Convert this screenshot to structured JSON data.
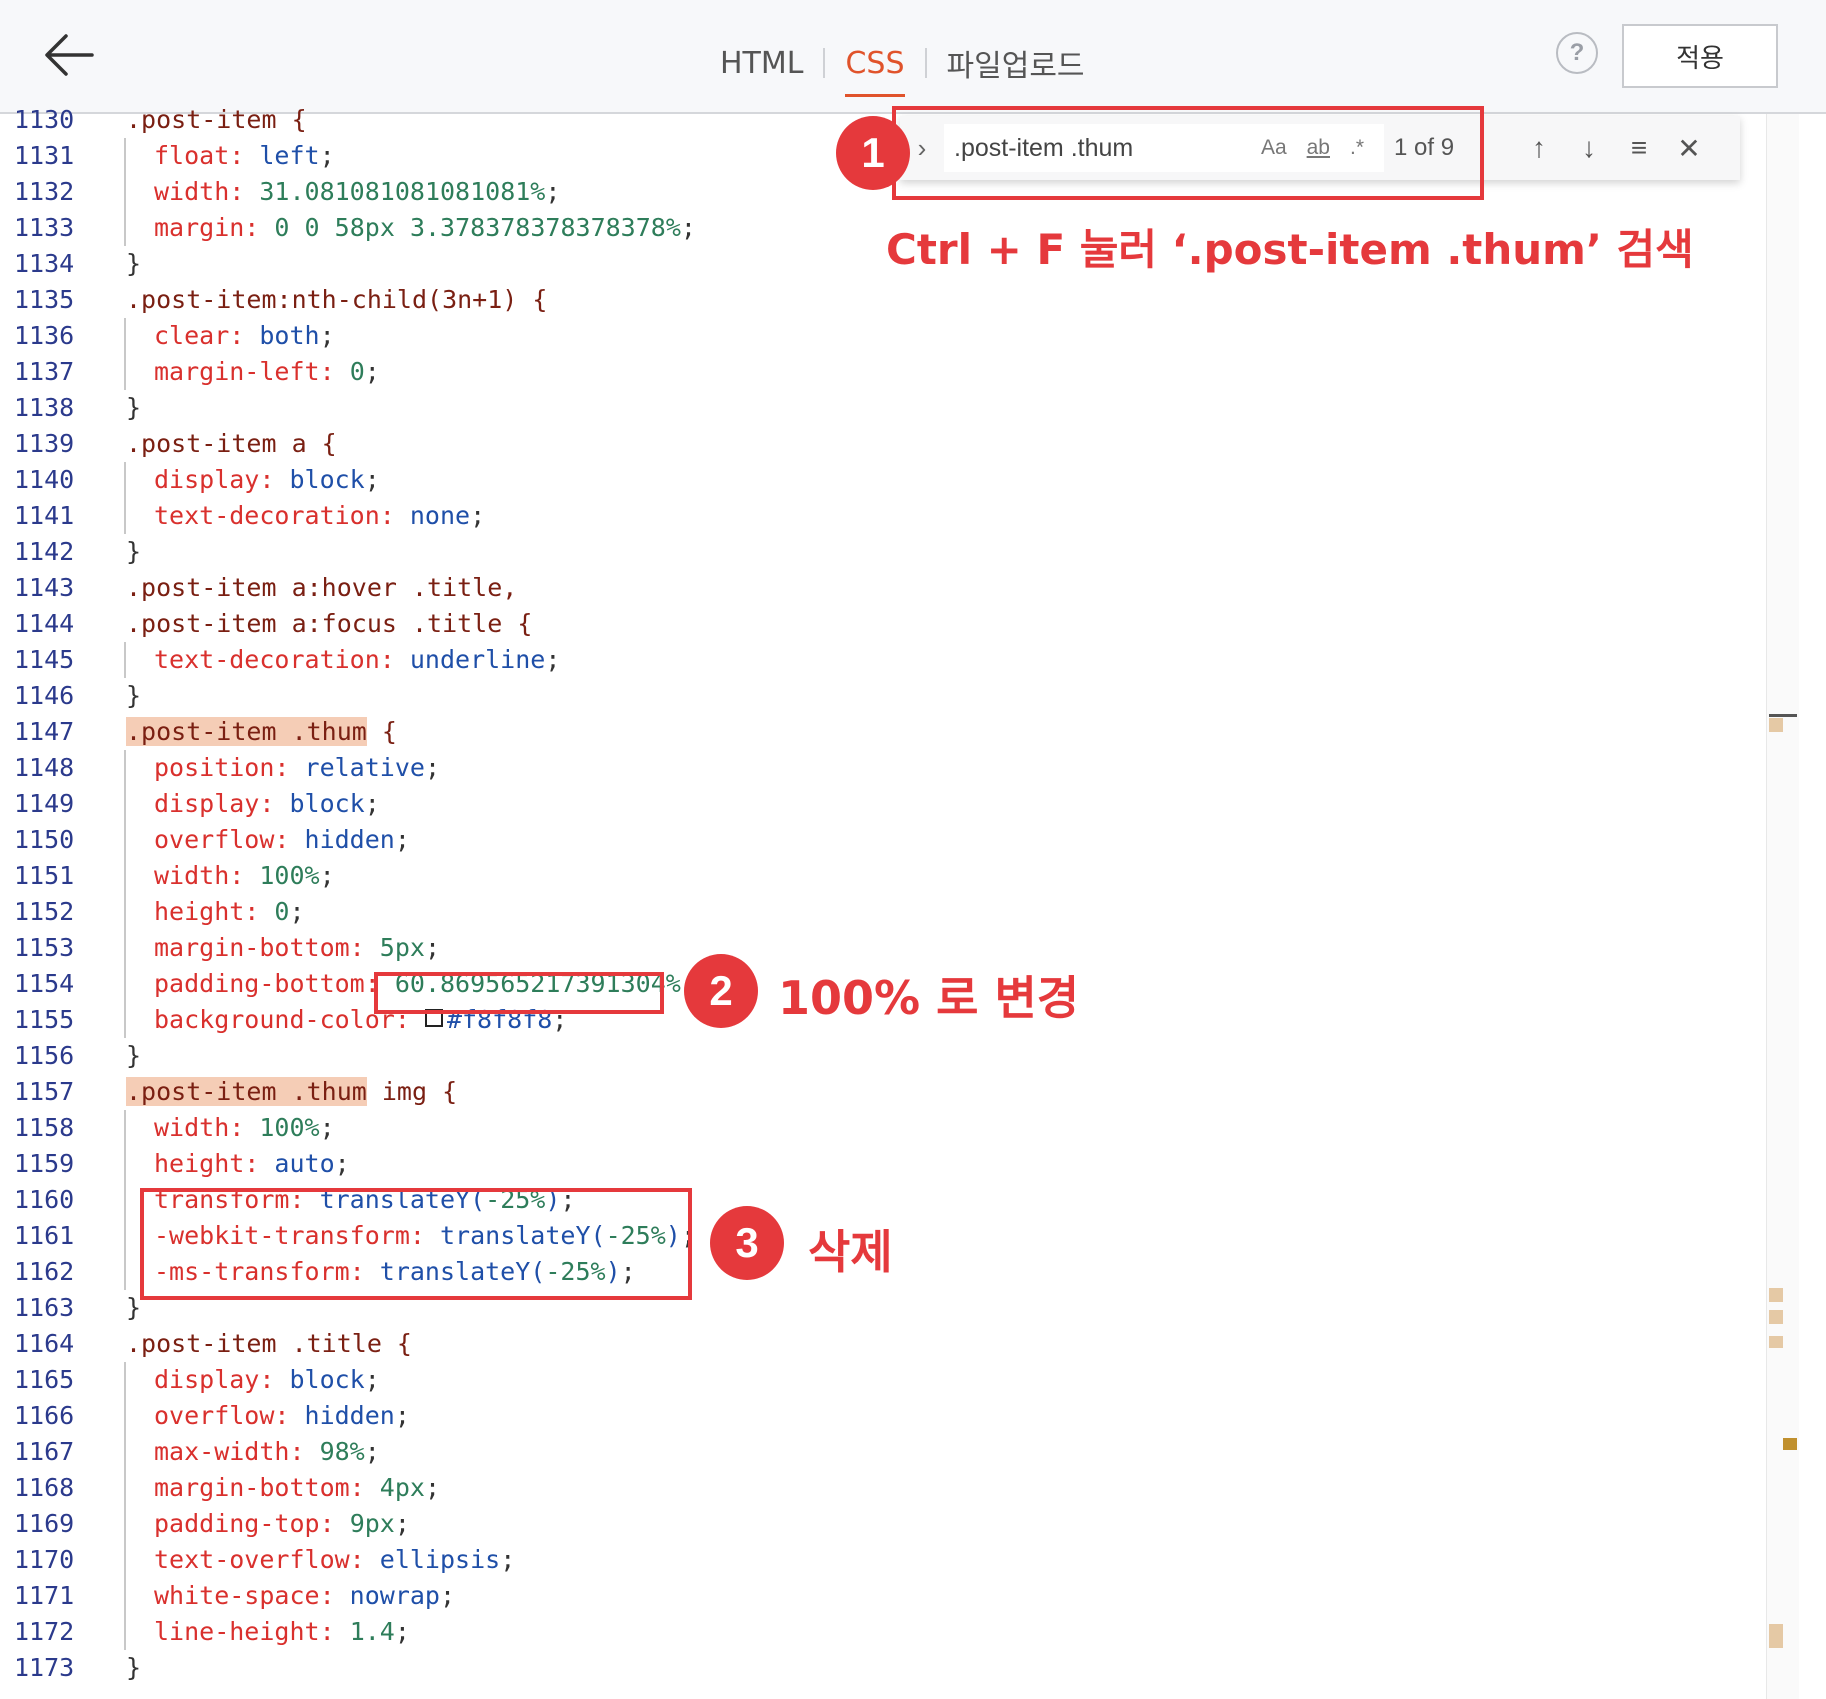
{
  "header": {
    "back_icon": "arrow-left-icon",
    "tabs": [
      {
        "label": "HTML",
        "active": false
      },
      {
        "label": "CSS",
        "active": true
      },
      {
        "label": "파일업로드",
        "active": false
      }
    ],
    "help_label": "?",
    "apply_label": "적용"
  },
  "find": {
    "query": ".post-item .thum",
    "match_case": "Aa",
    "whole_word": "ab",
    "regex": ".*",
    "count": "1 of 9"
  },
  "annotations": {
    "step1": {
      "badge": "1",
      "text": "Ctrl + F 눌러 ‘.post-item .thum’ 검색"
    },
    "step2": {
      "badge": "2",
      "text": "100% 로 변경"
    },
    "step3": {
      "badge": "3",
      "text": "삭제"
    }
  },
  "colors": {
    "accent": "#e0532b",
    "annotation": "#e5393c",
    "highlight": "#f5cdb6"
  },
  "lines": [
    {
      "n": "1130",
      "t": ".post-item {"
    },
    {
      "n": "1131",
      "t": "float: left;"
    },
    {
      "n": "1132",
      "t": "width: 31.081081081081081%;"
    },
    {
      "n": "1133",
      "t": "margin: 0 0 58px 3.378378378378378%;"
    },
    {
      "n": "1134",
      "t": "}"
    },
    {
      "n": "1135",
      "t": ".post-item:nth-child(3n+1) {"
    },
    {
      "n": "1136",
      "t": "clear: both;"
    },
    {
      "n": "1137",
      "t": "margin-left: 0;"
    },
    {
      "n": "1138",
      "t": "}"
    },
    {
      "n": "1139",
      "t": ".post-item a {"
    },
    {
      "n": "1140",
      "t": "display: block;"
    },
    {
      "n": "1141",
      "t": "text-decoration: none;"
    },
    {
      "n": "1142",
      "t": "}"
    },
    {
      "n": "1143",
      "t": ".post-item a:hover .title,"
    },
    {
      "n": "1144",
      "t": ".post-item a:focus .title {"
    },
    {
      "n": "1145",
      "t": "text-decoration: underline;"
    },
    {
      "n": "1146",
      "t": "}"
    },
    {
      "n": "1147",
      "t": ".post-item .thum {"
    },
    {
      "n": "1148",
      "t": "position: relative;"
    },
    {
      "n": "1149",
      "t": "display: block;"
    },
    {
      "n": "1150",
      "t": "overflow: hidden;"
    },
    {
      "n": "1151",
      "t": "width: 100%;"
    },
    {
      "n": "1152",
      "t": "height: 0;"
    },
    {
      "n": "1153",
      "t": "margin-bottom: 5px;"
    },
    {
      "n": "1154",
      "t": "padding-bottom: 60.869565217391304%;"
    },
    {
      "n": "1155",
      "t": "background-color: #f8f8f8;"
    },
    {
      "n": "1156",
      "t": "}"
    },
    {
      "n": "1157",
      "t": ".post-item .thum img {"
    },
    {
      "n": "1158",
      "t": "width: 100%;"
    },
    {
      "n": "1159",
      "t": "height: auto;"
    },
    {
      "n": "1160",
      "t": "transform: translateY(-25%);"
    },
    {
      "n": "1161",
      "t": "-webkit-transform: translateY(-25%);"
    },
    {
      "n": "1162",
      "t": "-ms-transform: translateY(-25%);"
    },
    {
      "n": "1163",
      "t": "}"
    },
    {
      "n": "1164",
      "t": ".post-item .title {"
    },
    {
      "n": "1165",
      "t": "display: block;"
    },
    {
      "n": "1166",
      "t": "overflow: hidden;"
    },
    {
      "n": "1167",
      "t": "max-width: 98%;"
    },
    {
      "n": "1168",
      "t": "margin-bottom: 4px;"
    },
    {
      "n": "1169",
      "t": "padding-top: 9px;"
    },
    {
      "n": "1170",
      "t": "text-overflow: ellipsis;"
    },
    {
      "n": "1171",
      "t": "white-space: nowrap;"
    },
    {
      "n": "1172",
      "t": "line-height: 1.4;"
    },
    {
      "n": "1173",
      "t": "}"
    }
  ]
}
